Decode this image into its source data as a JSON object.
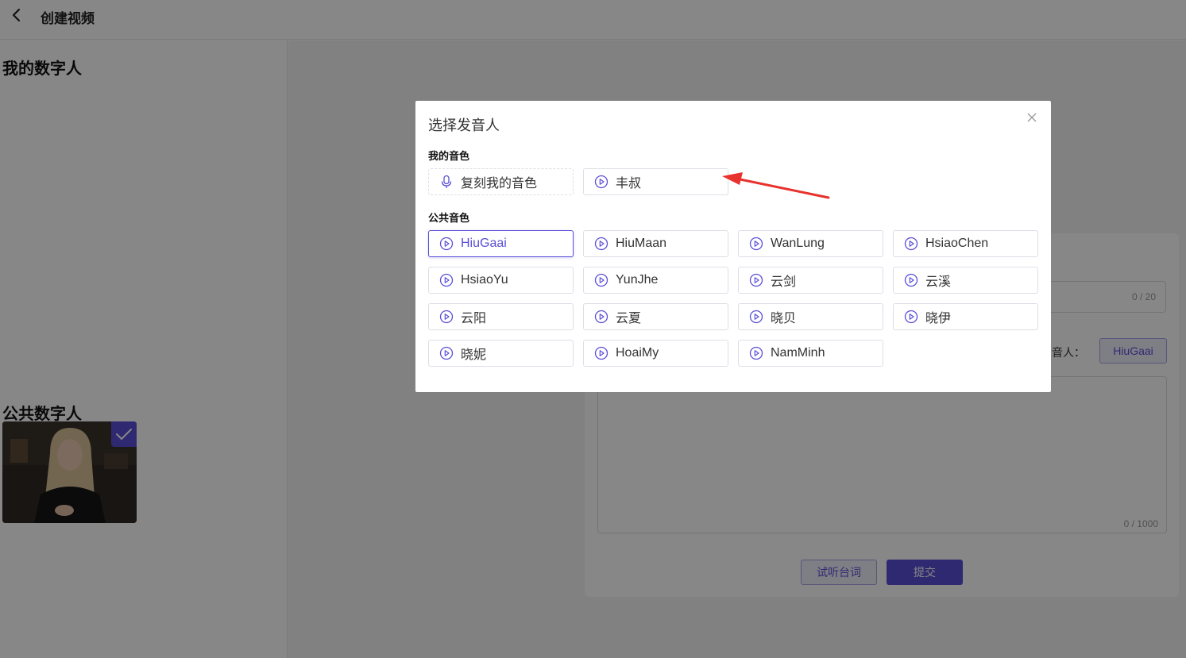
{
  "header": {
    "title": "创建视频"
  },
  "left_panel": {
    "my_avatars_title": "我的数字人",
    "public_avatars_title": "公共数字人"
  },
  "form": {
    "title_count": "0 / 20",
    "voice_label": "择发音人：",
    "voice_selected": "HiuGaai",
    "script_count": "0 / 1000",
    "preview_label": "试听台词",
    "submit_label": "提交"
  },
  "modal": {
    "title": "选择发音人",
    "my_voices_label": "我的音色",
    "clone_label": "复刻我的音色",
    "my_voices": [
      "丰叔"
    ],
    "public_voices_label": "公共音色",
    "public_voices": [
      "HiuGaai",
      "HiuMaan",
      "WanLung",
      "HsiaoChen",
      "HsiaoYu",
      "YunJhe",
      "云剑",
      "云溪",
      "云阳",
      "云夏",
      "晓贝",
      "晓伊",
      "晓妮",
      "HoaiMy",
      "NamMinh"
    ],
    "selected_voice": "HiuGaai"
  },
  "colors": {
    "accent": "#5a4fd6",
    "annotation_arrow": "#e8322e"
  }
}
